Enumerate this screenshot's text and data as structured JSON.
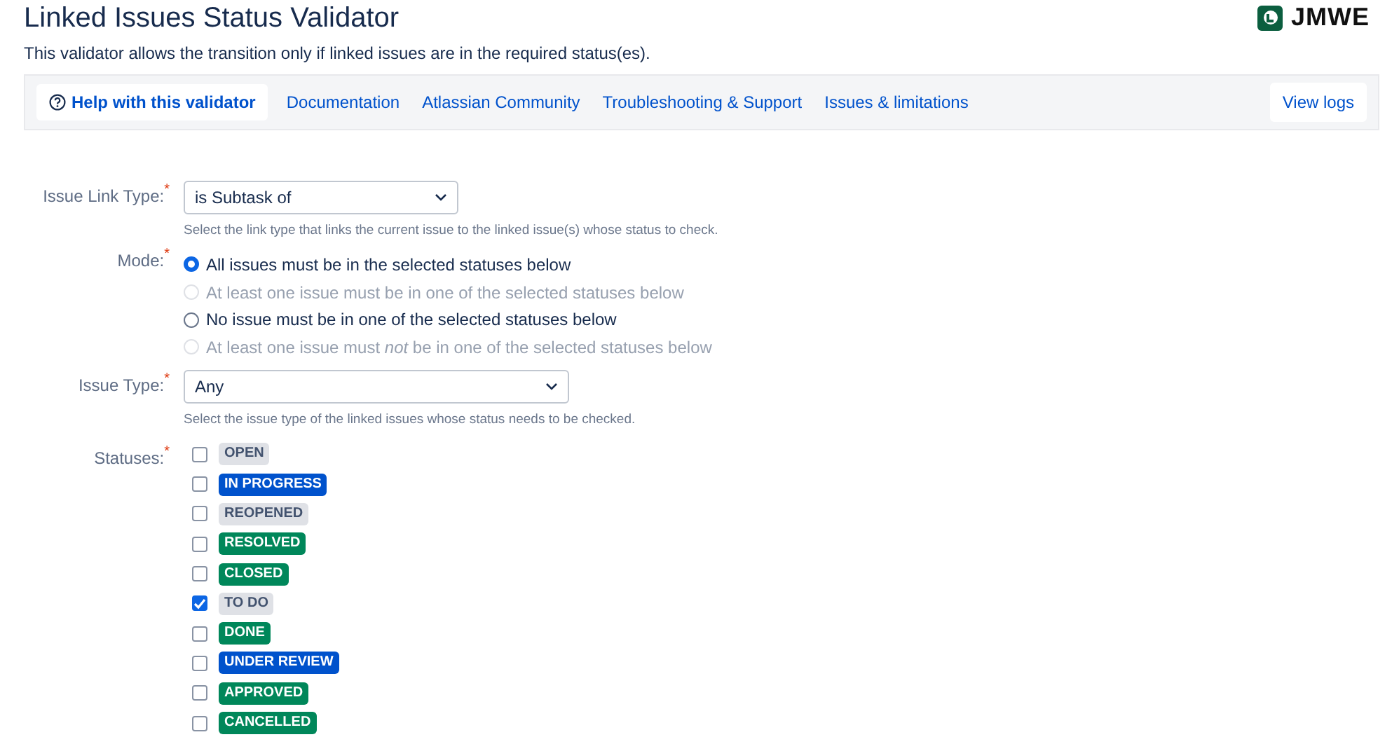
{
  "header": {
    "title": "Linked Issues Status Validator",
    "description": "This validator allows the transition only if linked issues are in the required status(es).",
    "logo_text": "JMWE"
  },
  "nav": {
    "links": [
      {
        "label": "Help with this validator",
        "selected": true,
        "kind": "help"
      },
      {
        "label": "Documentation",
        "selected": false,
        "kind": "link"
      },
      {
        "label": "Atlassian Community",
        "selected": false,
        "kind": "link"
      },
      {
        "label": "Troubleshooting & Support",
        "selected": false,
        "kind": "link"
      },
      {
        "label": "Issues & limitations",
        "selected": false,
        "kind": "link"
      }
    ],
    "view_logs": "View logs"
  },
  "form": {
    "required_mark": "*",
    "link_type": {
      "label": "Issue Link Type:",
      "value": "is Subtask of",
      "help": "Select the link type that links the current issue to the linked issue(s) whose status to check."
    },
    "mode": {
      "label": "Mode:",
      "options": [
        {
          "label": "All issues must be in the selected statuses below",
          "selected": true,
          "disabled": false
        },
        {
          "label": "At least one issue must be in one of the selected statuses below",
          "selected": false,
          "disabled": true
        },
        {
          "label": "No issue must be in one of the selected statuses below",
          "selected": false,
          "disabled": false
        },
        {
          "label": "At least one issue must *not* be in one of the selected statuses below",
          "selected": false,
          "disabled": true
        }
      ]
    },
    "issue_type": {
      "label": "Issue Type:",
      "value": "Any",
      "help": "Select the issue type of the linked issues whose status needs to be checked."
    },
    "statuses": {
      "label": "Statuses:",
      "items": [
        {
          "name": "OPEN",
          "checked": false,
          "color": "#dfe1e6"
        },
        {
          "name": "IN PROGRESS",
          "checked": false,
          "color": "#0052cc"
        },
        {
          "name": "REOPENED",
          "checked": false,
          "color": "#dfe1e6"
        },
        {
          "name": "RESOLVED",
          "checked": false,
          "color": "#00875a"
        },
        {
          "name": "CLOSED",
          "checked": false,
          "color": "#00875a"
        },
        {
          "name": "TO DO",
          "checked": true,
          "color": "#dfe1e6"
        },
        {
          "name": "DONE",
          "checked": false,
          "color": "#00875a"
        },
        {
          "name": "UNDER REVIEW",
          "checked": false,
          "color": "#0052cc"
        },
        {
          "name": "APPROVED",
          "checked": false,
          "color": "#00875a"
        },
        {
          "name": "CANCELLED",
          "checked": false,
          "color": "#00875a"
        }
      ]
    }
  }
}
